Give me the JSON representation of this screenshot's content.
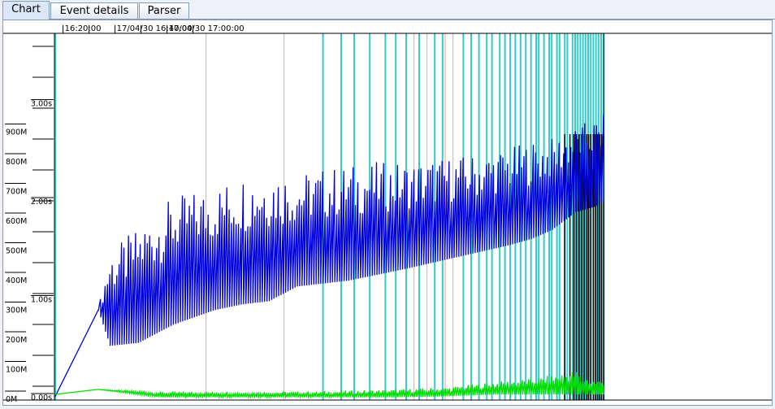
{
  "tabs": [
    {
      "label": "Chart",
      "active": true
    },
    {
      "label": "Event details",
      "active": false
    },
    {
      "label": "Parser",
      "active": false
    }
  ],
  "chart_data": {
    "type": "line",
    "x_axis": {
      "tick_labels": [
        "16:20:00",
        "17/04/30 16:40:00",
        "17/04/30 17:00:00"
      ],
      "range": [
        "16:17:00",
        "17:07:00"
      ]
    },
    "y_axis_memory": {
      "tick_labels": [
        "0M",
        "100M",
        "200M",
        "300M",
        "400M",
        "500M",
        "600M",
        "700M",
        "800M",
        "900M"
      ],
      "range": [
        0,
        1000
      ]
    },
    "y_axis_time": {
      "tick_labels": [
        "0.00s",
        "1.00s",
        "2.00s",
        "3.00s"
      ],
      "range": [
        0,
        3.9
      ]
    },
    "series": [
      {
        "color": "#0000dd",
        "axis": "memory",
        "x_min": [
          0,
          16.5,
          21,
          32,
          45,
          61,
          72,
          82,
          93,
          103,
          113,
          124,
          135,
          145,
          155,
          165,
          175,
          183,
          191,
          200,
          208,
          211
        ],
        "troughs": [
          10,
          300,
          180,
          190,
          250,
          300,
          320,
          330,
          380,
          390,
          400,
          420,
          440,
          460,
          480,
          500,
          520,
          540,
          570,
          630,
          650,
          670
        ],
        "peaks": [
          10,
          300,
          500,
          580,
          680,
          720,
          760,
          780,
          760,
          780,
          790,
          800,
          800,
          810,
          820,
          830,
          850,
          870,
          880,
          920,
          950,
          960
        ]
      },
      {
        "color": "#00dd00",
        "axis": "time",
        "x_min": [
          0,
          16.5,
          40,
          70,
          100,
          130,
          150,
          160,
          170,
          178,
          185,
          192,
          200,
          206,
          211
        ],
        "troughs": [
          0.05,
          0.1,
          0.02,
          0.02,
          0.02,
          0.02,
          0.03,
          0.04,
          0.05,
          0.05,
          0.05,
          0.05,
          0.05,
          0.05,
          0.05
        ],
        "peaks": [
          0.05,
          0.1,
          0.08,
          0.08,
          0.08,
          0.1,
          0.12,
          0.15,
          0.18,
          0.2,
          0.22,
          0.25,
          0.3,
          0.2,
          0.2
        ]
      }
    ],
    "event_lines": {
      "cyan_color": "#33cccc",
      "pink_color": "#f0a0a0",
      "black_color": "#000000",
      "pink_x_min": [
        58,
        88,
        138,
        143,
        150,
        153
      ],
      "cyan_x_min": [
        0,
        103,
        110,
        115,
        121,
        127,
        131,
        135,
        140,
        146,
        149,
        157,
        160,
        163,
        166,
        168,
        171,
        173,
        175,
        177,
        179,
        181,
        183,
        185,
        186,
        188,
        190,
        191,
        193,
        194,
        196,
        197,
        199,
        200,
        201,
        202,
        203,
        204,
        205,
        206,
        207,
        208,
        209,
        210,
        211
      ],
      "black_x_min": [
        196,
        198,
        199.5,
        200.5,
        201.5,
        202.5,
        203.5,
        204.5,
        205.2,
        206,
        207,
        207.8,
        208.6,
        209.4,
        210.2,
        211
      ],
      "end_x_min": 211
    }
  }
}
